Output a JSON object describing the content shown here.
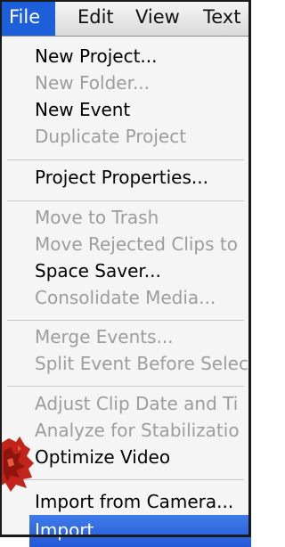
{
  "menubar": {
    "items": [
      "File",
      "Edit",
      "View",
      "Text"
    ]
  },
  "file_menu": {
    "groups": [
      [
        {
          "label": "New Project...",
          "enabled": true
        },
        {
          "label": "New Folder...",
          "enabled": false
        },
        {
          "label": "New Event",
          "enabled": true
        },
        {
          "label": "Duplicate Project",
          "enabled": false
        }
      ],
      [
        {
          "label": "Project Properties...",
          "enabled": true
        }
      ],
      [
        {
          "label": "Move to Trash",
          "enabled": false
        },
        {
          "label": "Move Rejected Clips to",
          "enabled": false
        },
        {
          "label": "Space Saver...",
          "enabled": true
        },
        {
          "label": "Consolidate Media...",
          "enabled": false
        }
      ],
      [
        {
          "label": "Merge Events...",
          "enabled": false
        },
        {
          "label": "Split Event Before Selec",
          "enabled": false
        }
      ],
      [
        {
          "label": "Adjust Clip Date and Ti",
          "enabled": false
        },
        {
          "label": "Analyze for Stabilizatio",
          "enabled": false
        },
        {
          "label": "Optimize Video",
          "enabled": true
        }
      ],
      [
        {
          "label": "Import from Camera...",
          "enabled": true
        },
        {
          "label": "Import",
          "enabled": true,
          "highlighted": true
        }
      ]
    ]
  },
  "colors": {
    "selection": "#1c5fd8",
    "disabled_text": "#9d9d9d",
    "menu_background": "#f5f5f5"
  }
}
